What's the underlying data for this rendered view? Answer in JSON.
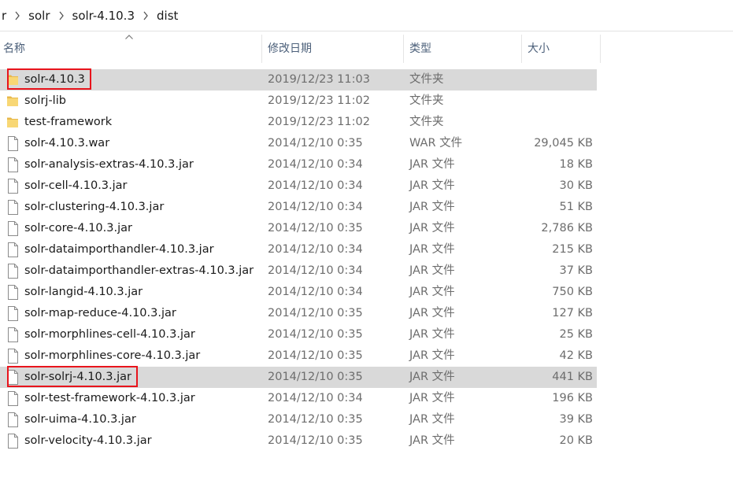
{
  "breadcrumb": {
    "items": [
      "r",
      "solr",
      "solr-4.10.3",
      "dist"
    ]
  },
  "columns": {
    "name": "名称",
    "date": "修改日期",
    "type": "类型",
    "size": "大小"
  },
  "files": [
    {
      "name": "solr-4.10.3",
      "date": "2019/12/23 11:03",
      "type": "文件夹",
      "size": "",
      "kind": "folder",
      "selected": true,
      "highlighted": true
    },
    {
      "name": "solrj-lib",
      "date": "2019/12/23 11:02",
      "type": "文件夹",
      "size": "",
      "kind": "folder"
    },
    {
      "name": "test-framework",
      "date": "2019/12/23 11:02",
      "type": "文件夹",
      "size": "",
      "kind": "folder"
    },
    {
      "name": "solr-4.10.3.war",
      "date": "2014/12/10 0:35",
      "type": "WAR 文件",
      "size": "29,045 KB",
      "kind": "file"
    },
    {
      "name": "solr-analysis-extras-4.10.3.jar",
      "date": "2014/12/10 0:34",
      "type": "JAR 文件",
      "size": "18 KB",
      "kind": "file"
    },
    {
      "name": "solr-cell-4.10.3.jar",
      "date": "2014/12/10 0:34",
      "type": "JAR 文件",
      "size": "30 KB",
      "kind": "file"
    },
    {
      "name": "solr-clustering-4.10.3.jar",
      "date": "2014/12/10 0:34",
      "type": "JAR 文件",
      "size": "51 KB",
      "kind": "file"
    },
    {
      "name": "solr-core-4.10.3.jar",
      "date": "2014/12/10 0:35",
      "type": "JAR 文件",
      "size": "2,786 KB",
      "kind": "file"
    },
    {
      "name": "solr-dataimporthandler-4.10.3.jar",
      "date": "2014/12/10 0:34",
      "type": "JAR 文件",
      "size": "215 KB",
      "kind": "file"
    },
    {
      "name": "solr-dataimporthandler-extras-4.10.3.jar",
      "date": "2014/12/10 0:34",
      "type": "JAR 文件",
      "size": "37 KB",
      "kind": "file"
    },
    {
      "name": "solr-langid-4.10.3.jar",
      "date": "2014/12/10 0:34",
      "type": "JAR 文件",
      "size": "750 KB",
      "kind": "file"
    },
    {
      "name": "solr-map-reduce-4.10.3.jar",
      "date": "2014/12/10 0:35",
      "type": "JAR 文件",
      "size": "127 KB",
      "kind": "file"
    },
    {
      "name": "solr-morphlines-cell-4.10.3.jar",
      "date": "2014/12/10 0:35",
      "type": "JAR 文件",
      "size": "25 KB",
      "kind": "file"
    },
    {
      "name": "solr-morphlines-core-4.10.3.jar",
      "date": "2014/12/10 0:35",
      "type": "JAR 文件",
      "size": "42 KB",
      "kind": "file"
    },
    {
      "name": "solr-solrj-4.10.3.jar",
      "date": "2014/12/10 0:35",
      "type": "JAR 文件",
      "size": "441 KB",
      "kind": "file",
      "selected": true,
      "highlighted": true
    },
    {
      "name": "solr-test-framework-4.10.3.jar",
      "date": "2014/12/10 0:34",
      "type": "JAR 文件",
      "size": "196 KB",
      "kind": "file"
    },
    {
      "name": "solr-uima-4.10.3.jar",
      "date": "2014/12/10 0:35",
      "type": "JAR 文件",
      "size": "39 KB",
      "kind": "file"
    },
    {
      "name": "solr-velocity-4.10.3.jar",
      "date": "2014/12/10 0:35",
      "type": "JAR 文件",
      "size": "20 KB",
      "kind": "file"
    }
  ],
  "colors": {
    "folder": "#f8d775",
    "selection": "#d9d9d9",
    "highlight_border": "#e8141c",
    "header_text": "#4c607a"
  },
  "icons": {
    "folder": "folder-icon",
    "file": "file-icon",
    "separator": "chevron-right-icon",
    "sort": "sort-ascending-icon"
  }
}
